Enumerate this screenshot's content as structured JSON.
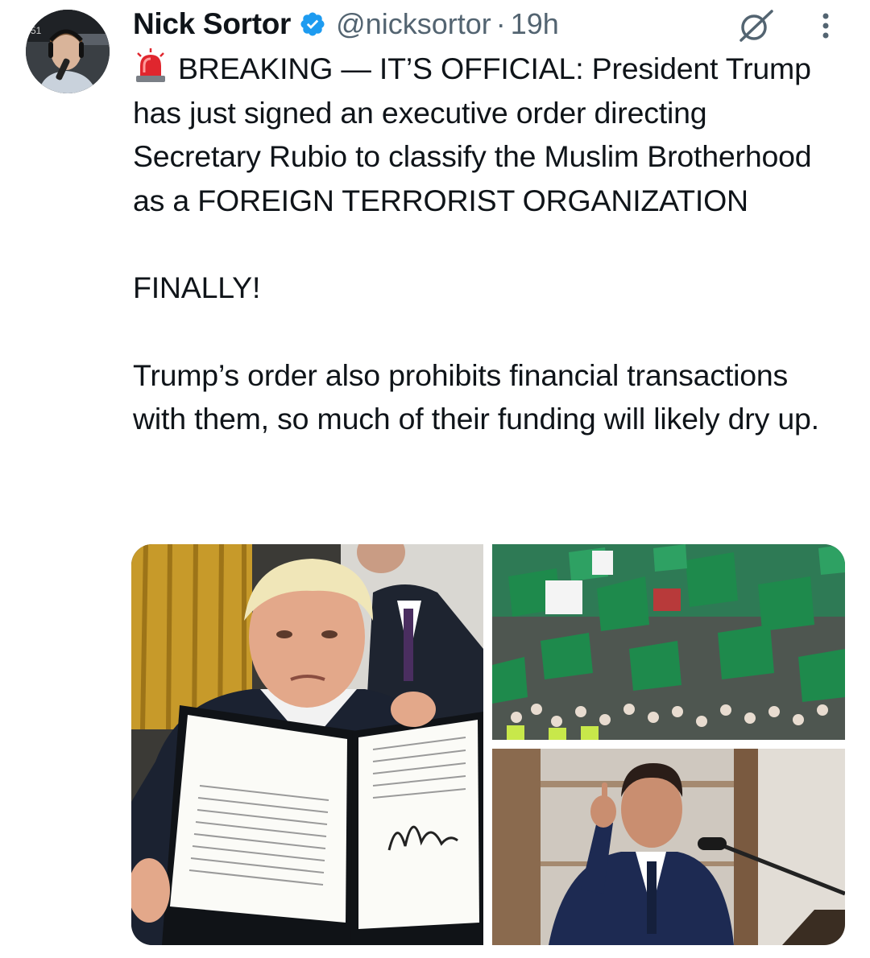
{
  "author": {
    "display_name": "Nick Sortor",
    "handle": "@nicksortor",
    "separator": "·",
    "timestamp": "19h",
    "verified": true
  },
  "tweet": {
    "emoji": "rotating-light-icon",
    "paragraphs": [
      "BREAKING — IT’S OFFICIAL: President Trump has just signed an executive order directing Secretary Rubio to classify the Muslim Brotherhood as a FOREIGN TERRORIST ORGANIZATION",
      "FINALLY!",
      "Trump’s order also prohibits financial transactions with them, so much of their funding will likely dry up."
    ]
  },
  "media": {
    "count": 3,
    "images": [
      "photo-president-holding-signed-order",
      "photo-crowd-with-green-flags",
      "photo-speaker-at-podium"
    ]
  },
  "colors": {
    "text": "#0f1419",
    "secondary": "#536471",
    "verified_blue": "#1d9bf0",
    "flag_green": "#1e8a4c"
  }
}
